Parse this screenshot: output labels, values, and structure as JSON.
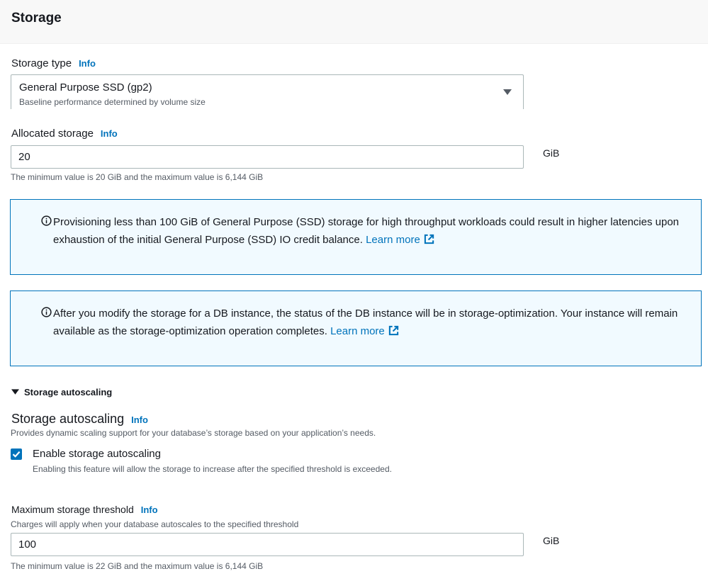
{
  "header": {
    "title": "Storage"
  },
  "storage_type": {
    "label": "Storage type",
    "info": "Info",
    "selected_value": "General Purpose SSD (gp2)",
    "selected_description": "Baseline performance determined by volume size"
  },
  "allocated_storage": {
    "label": "Allocated storage",
    "info": "Info",
    "value": "20",
    "unit": "GiB",
    "hint": "The minimum value is 20 GiB and the maximum value is 6,144 GiB"
  },
  "alerts": [
    {
      "text": "Provisioning less than 100 GiB of General Purpose (SSD) storage for high throughput workloads could result in higher latencies upon exhaustion of the initial General Purpose (SSD) IO credit balance.",
      "link": "Learn more"
    },
    {
      "text": "After you modify the storage for a DB instance, the status of the DB instance will be in storage-optimization. Your instance will remain available as the storage-optimization operation completes.",
      "link": "Learn more"
    }
  ],
  "autoscaling": {
    "expander_label": "Storage autoscaling",
    "title": "Storage autoscaling",
    "info": "Info",
    "description": "Provides dynamic scaling support for your database’s storage based on your application’s needs.",
    "checkbox_label": "Enable storage autoscaling",
    "checkbox_checked": true,
    "checkbox_description": "Enabling this feature will allow the storage to increase after the specified threshold is exceeded."
  },
  "max_threshold": {
    "label": "Maximum storage threshold",
    "info": "Info",
    "description": "Charges will apply when your database autoscales to the specified threshold",
    "value": "100",
    "unit": "GiB",
    "hint": "The minimum value is 22 GiB and the maximum value is 6,144 GiB"
  },
  "colors": {
    "link": "#0073bb",
    "alert_border": "#0073bb",
    "alert_background": "#f1faff",
    "header_background": "#f8f8f8"
  },
  "icons": [
    "info-circle-icon",
    "external-link-icon",
    "caret-down-icon",
    "checkmark-icon"
  ]
}
